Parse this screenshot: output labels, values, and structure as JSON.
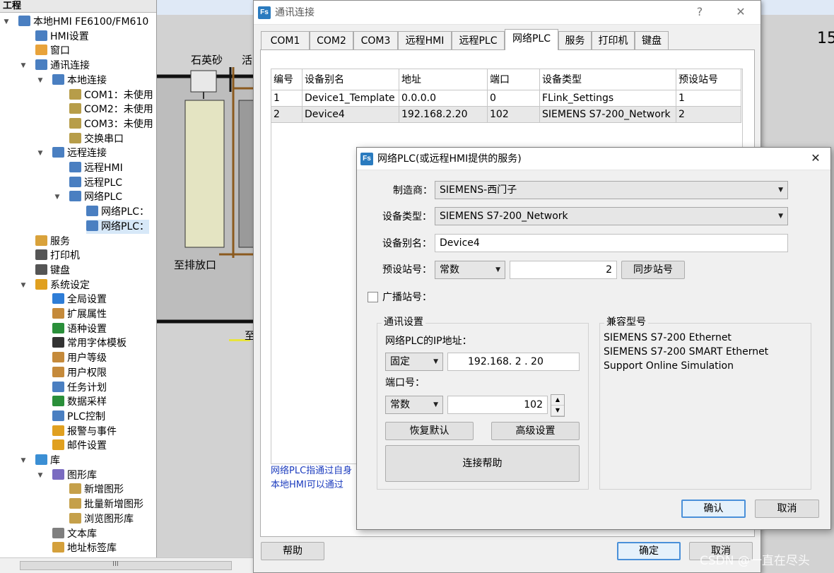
{
  "tree": {
    "title": "工程",
    "items": [
      {
        "label": "本地HMI FE6100/FM610",
        "icon": "hmi-monitor-icon"
      },
      {
        "label": "HMI设置",
        "icon": "settings-icon"
      },
      {
        "label": "窗口",
        "icon": "window-icon"
      },
      {
        "label": "通讯连接",
        "icon": "network-icon"
      },
      {
        "label": "本地连接",
        "icon": "network-icon"
      },
      {
        "label": "COM1：未使用",
        "icon": "serial-port-icon"
      },
      {
        "label": "COM2：未使用",
        "icon": "serial-port-icon"
      },
      {
        "label": "COM3：未使用",
        "icon": "serial-port-icon"
      },
      {
        "label": "交换串口",
        "icon": "swap-port-icon"
      },
      {
        "label": "远程连接",
        "icon": "network-icon"
      },
      {
        "label": "远程HMI",
        "icon": "monitor-icon"
      },
      {
        "label": "远程PLC",
        "icon": "monitor-icon"
      },
      {
        "label": "网络PLC",
        "icon": "monitor-icon"
      },
      {
        "label": "网络PLC：",
        "icon": "monitor-icon"
      },
      {
        "label": "网络PLC：",
        "icon": "monitor-icon"
      },
      {
        "label": "服务",
        "icon": "users-icon"
      },
      {
        "label": "打印机",
        "icon": "printer-icon"
      },
      {
        "label": "键盘",
        "icon": "keyboard-icon"
      },
      {
        "label": "系统设定",
        "icon": "gear-icon"
      },
      {
        "label": "全局设置",
        "icon": "globe-icon"
      },
      {
        "label": "扩展属性",
        "icon": "extension-icon"
      },
      {
        "label": "语种设置",
        "icon": "language-icon"
      },
      {
        "label": "常用字体模板",
        "icon": "font-icon"
      },
      {
        "label": "用户等级",
        "icon": "user-icon"
      },
      {
        "label": "用户权限",
        "icon": "user-icon"
      },
      {
        "label": "任务计划",
        "icon": "schedule-icon"
      },
      {
        "label": "数据采样",
        "icon": "chart-icon"
      },
      {
        "label": "PLC控制",
        "icon": "plc-icon"
      },
      {
        "label": "报警与事件",
        "icon": "warning-icon"
      },
      {
        "label": "邮件设置",
        "icon": "warning-icon"
      },
      {
        "label": "库",
        "icon": "database-icon"
      },
      {
        "label": "图形库",
        "icon": "image-icon"
      },
      {
        "label": "新增图形",
        "icon": "image-add-icon"
      },
      {
        "label": "批量新增图形",
        "icon": "image-add-icon"
      },
      {
        "label": "浏览图形库",
        "icon": "image-add-icon"
      },
      {
        "label": "文本库",
        "icon": "text-icon"
      },
      {
        "label": "地址标签库",
        "icon": "tag-icon"
      }
    ],
    "hscroll_grip": "III"
  },
  "canvas": {
    "label_sand": "石英砂",
    "label_activated": "活",
    "label_drain": "至排放口",
    "label_to": "至",
    "corner_number": "15"
  },
  "main_dialog": {
    "title": "通讯连接",
    "help_glyph": "?",
    "close_glyph": "✕",
    "tabs": [
      "COM1",
      "COM2",
      "COM3",
      "远程HMI",
      "远程PLC",
      "网络PLC",
      "服务",
      "打印机",
      "键盘"
    ],
    "active_tab": "网络PLC",
    "table": {
      "headers": [
        "编号",
        "设备别名",
        "地址",
        "端口",
        "设备类型",
        "预设站号"
      ],
      "rows": [
        [
          "1",
          "Device1_Template",
          "0.0.0.0",
          "0",
          "FLink_Settings",
          "1"
        ],
        [
          "2",
          "Device4",
          "192.168.2.20",
          "102",
          "SIEMENS S7-200_Network",
          "2"
        ]
      ]
    },
    "note_line1": "网络PLC指通过自身",
    "note_line2": "本地HMI可以通过",
    "help_button": "帮助",
    "ok_button": "确定",
    "cancel_button": "取消"
  },
  "plc_dialog": {
    "title": "网络PLC(或远程HMI提供的服务)",
    "close_glyph": "✕",
    "manufacturer_label": "制造商：",
    "manufacturer_value": "SIEMENS-西门子",
    "device_type_label": "设备类型：",
    "device_type_value": "SIEMENS S7-200_Network",
    "alias_label": "设备别名：",
    "alias_value": "Device4",
    "station_label": "预设站号：",
    "station_mode": "常数",
    "station_value": "2",
    "sync_button": "同步站号",
    "broadcast_label": "广播站号：",
    "comm_group_title": "通讯设置",
    "ip_label": "网络PLC的IP地址：",
    "ip_mode": "固定",
    "ip_value": "192.168. 2 . 20",
    "port_label": "端口号：",
    "port_mode": "常数",
    "port_value": "102",
    "restore_button": "恢复默认",
    "advanced_button": "高级设置",
    "connect_help_button": "连接帮助",
    "compat_group_title": "兼容型号",
    "compat_models": [
      "SIEMENS S7-200 Ethernet",
      "SIEMENS S7-200 SMART Ethernet",
      "Support Online Simulation"
    ],
    "ok_button": "确认",
    "cancel_button": "取消"
  },
  "watermark": "CSDN @一直在尽头",
  "colors": {
    "accent": "#4a90d9",
    "link_text": "#1c3cbe",
    "selected_row": "#d7e8f8",
    "pipe": "#8b5a1f"
  }
}
